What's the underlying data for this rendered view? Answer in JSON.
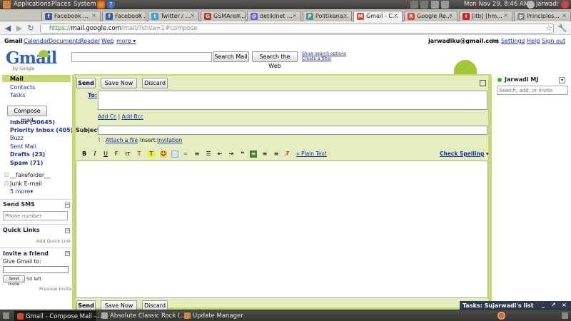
{
  "top_panel": {
    "menus": [
      "Applications",
      "Places",
      "System"
    ],
    "clock": "Mon Nov 29,  8:46 AM",
    "user": "jarwadi"
  },
  "tabs": [
    {
      "label": "Facebook ...",
      "color": "#3b5998",
      "glyph": "f"
    },
    {
      "label": "Facebook ...",
      "color": "#3b5998",
      "glyph": "f"
    },
    {
      "label": "Twitter / ...",
      "color": "#33a3d8",
      "glyph": "t"
    },
    {
      "label": "GSMAren...",
      "color": "#b33",
      "glyph": "G"
    },
    {
      "label": "detikInet ...",
      "color": "#6a5acd",
      "glyph": "@"
    },
    {
      "label": "Politikana...",
      "color": "#4a9a8a",
      "glyph": "P"
    },
    {
      "label": "Gmail - C...",
      "color": "#d14836",
      "glyph": "M"
    },
    {
      "label": "Google Re...",
      "color": "#d14836",
      "glyph": "R"
    },
    {
      "label": "[itb] [hm...",
      "color": "#cc2222",
      "glyph": "i"
    },
    {
      "label": "Principles...",
      "color": "#888888",
      "glyph": "p"
    }
  ],
  "address": {
    "scheme": "https://",
    "host": "mail.google.com",
    "path": "/mail/?shva=1#compose"
  },
  "gmail_links": {
    "left": [
      "Gmail",
      "Calendar",
      "Documents",
      "Reader",
      "Web",
      "more ▾"
    ],
    "email": "jarwadiku@gmail.com",
    "right": [
      "Settings",
      "Help",
      "Sign out"
    ]
  },
  "logo": {
    "text": "Gmail",
    "sub": "by Google"
  },
  "search": {
    "mail_button": "Search Mail",
    "web_button": "Search the Web",
    "show_options": "Show search options",
    "create_filter": "Create a filter"
  },
  "nav": {
    "mail": "Mail",
    "contacts": "Contacts",
    "tasks": "Tasks",
    "compose": "Compose mail",
    "folders": [
      {
        "label": "Inbox (50645)",
        "bold": true
      },
      {
        "label": "Priority Inbox (405)",
        "bold": true
      },
      {
        "label": "Buzz",
        "bold": false
      },
      {
        "label": "Sent Mail",
        "bold": false
      },
      {
        "label": "Drafts (23)",
        "bold": true
      },
      {
        "label": "Spam (71)",
        "bold": true
      }
    ],
    "labels": [
      "__fakefolder__",
      "Junk E-mail"
    ],
    "more": "5 more▾"
  },
  "send_sms": {
    "title": "Send SMS",
    "placeholder": "Phone number"
  },
  "quick_links": {
    "title": "Quick Links",
    "add": "Add Quick Link"
  },
  "invite": {
    "title": "Invite a friend",
    "label": "Give Gmail to:",
    "button": "Send Invite",
    "left": "50 left",
    "preview": "Preview Invite"
  },
  "compose": {
    "send": "Send",
    "save": "Save Now",
    "discard": "Discard",
    "to_label": "To:",
    "add_cc": "Add Cc",
    "add_bcc": "Add Bcc",
    "subject_label": "Subject:",
    "attach": "Attach a file",
    "insert": "Insert:",
    "invitation": "Invitation",
    "plain_text": "« Plain Text",
    "spell": "Check Spelling",
    "spell_arrow": "▾"
  },
  "chat": {
    "name": "Jarwadi MJ",
    "search_placeholder": "Search, add, or invite"
  },
  "tasks_popup": {
    "title": "Tasks: Sujarwadi's list"
  },
  "taskbar": [
    {
      "label": "Gmail - Compose Mail -...",
      "active": true
    },
    {
      "label": "Absolute Classic Rock (...",
      "active": false
    },
    {
      "label": "Update Manager",
      "active": false
    }
  ],
  "colors": {
    "accent": "#c9d96f",
    "link": "#1a2ea8"
  }
}
